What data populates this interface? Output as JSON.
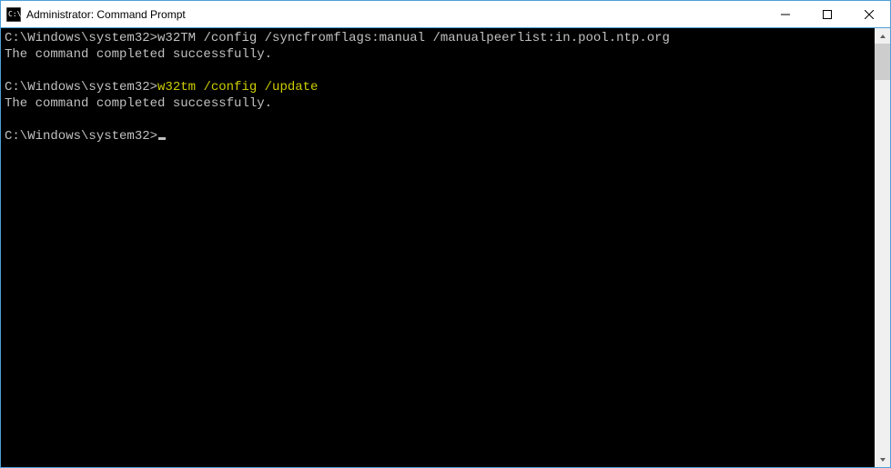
{
  "window": {
    "title": "Administrator: Command Prompt"
  },
  "terminal": {
    "lines": [
      {
        "prompt": "C:\\Windows\\system32>",
        "cmd": "w32TM /config /syncfromflags:manual /manualpeerlist:in.pool.ntp.org",
        "highlight": false
      },
      {
        "output": "The command completed successfully."
      },
      {
        "output": ""
      },
      {
        "prompt": "C:\\Windows\\system32>",
        "cmd": "w32tm /config /update",
        "highlight": true
      },
      {
        "output": "The command completed successfully."
      },
      {
        "output": ""
      },
      {
        "prompt": "C:\\Windows\\system32>",
        "cmd": "",
        "cursor": true
      }
    ]
  }
}
